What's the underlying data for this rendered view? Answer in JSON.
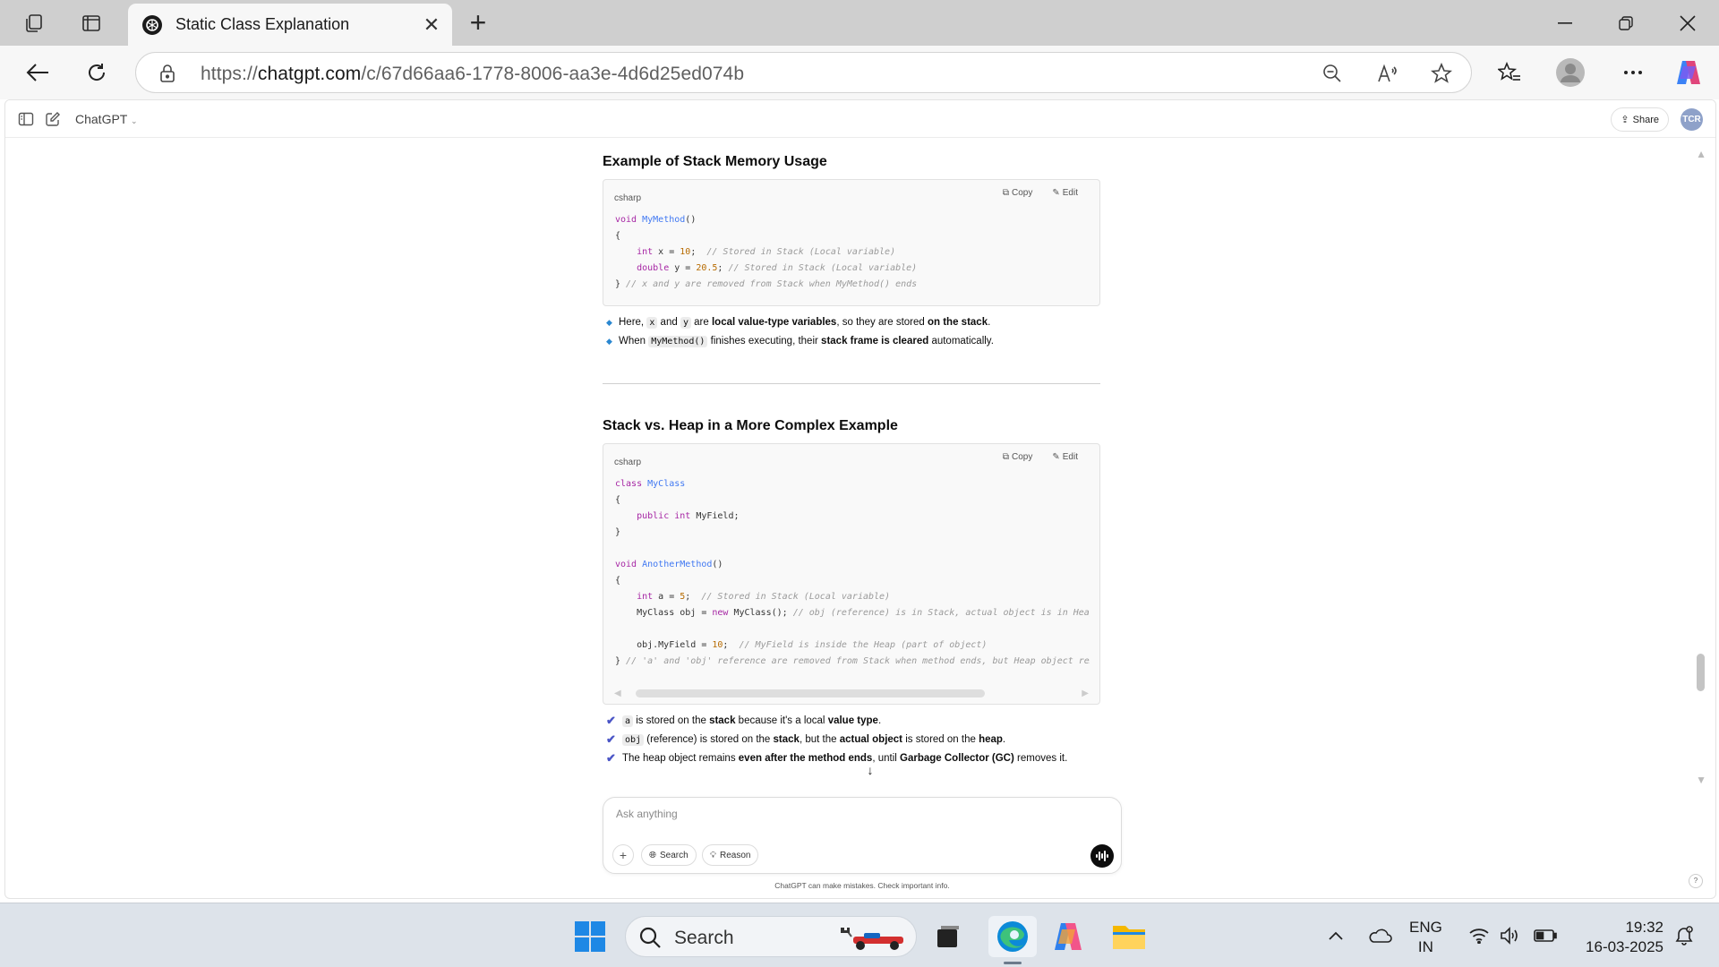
{
  "browser": {
    "tab_title": "Static Class Explanation",
    "url_prefix": "https://",
    "url_domain": "chatgpt.com",
    "url_path": "/c/67d66aa6-1778-8006-aa3e-4d6d25ed074b"
  },
  "app": {
    "model_label": "ChatGPT",
    "share_label": "Share",
    "avatar_initials": "TCR"
  },
  "sections": [
    {
      "heading": "Example of Stack Memory Usage",
      "lang": "csharp",
      "copy_label": "Copy",
      "edit_label": "Edit",
      "bullets": [
        {
          "parts": [
            "Here, ",
            "x",
            " and ",
            "y",
            " are ",
            "local value-type variables",
            ", so they are stored ",
            "on the stack",
            "."
          ]
        },
        {
          "parts": [
            "When ",
            "MyMethod()",
            " finishes executing, their ",
            "stack frame is cleared",
            " automatically."
          ]
        }
      ]
    },
    {
      "heading": "Stack vs. Heap in a More Complex Example",
      "lang": "csharp",
      "copy_label": "Copy",
      "edit_label": "Edit",
      "checks": [
        {
          "parts": [
            "a",
            " is stored on the ",
            "stack",
            " because it's a local ",
            "value type",
            "."
          ]
        },
        {
          "parts": [
            "obj",
            " (reference) is stored on the ",
            "stack",
            ", but the ",
            "actual object",
            " is stored on the ",
            "heap",
            "."
          ]
        },
        {
          "parts": [
            "The heap object remains ",
            "even after the method ends",
            ", until ",
            "Garbage Collector (GC)",
            " removes it."
          ]
        }
      ]
    }
  ],
  "code1": [
    "void MyMethod()",
    "{",
    "    int x = 10;  // Stored in Stack (Local variable)",
    "    double y = 20.5; // Stored in Stack (Local variable)",
    "} // x and y are removed from Stack when MyMethod() ends"
  ],
  "code2": [
    "class MyClass",
    "{",
    "    public int MyField;",
    "}",
    "",
    "void AnotherMethod()",
    "{",
    "    int a = 5;  // Stored in Stack (Local variable)",
    "    MyClass obj = new MyClass(); // obj (reference) is in Stack, actual object is in Heap",
    "",
    "    obj.MyField = 10;  // MyField is inside the Heap (part of object)",
    "} // 'a' and 'obj' reference are removed from Stack when method ends, but Heap object remains"
  ],
  "composer": {
    "placeholder": "Ask anything",
    "search_label": "Search",
    "reason_label": "Reason",
    "disclaimer": "ChatGPT can make mistakes. Check important info."
  },
  "taskbar": {
    "search_label": "Search",
    "lang_line1": "ENG",
    "lang_line2": "IN",
    "time": "19:32",
    "date": "16-03-2025"
  }
}
